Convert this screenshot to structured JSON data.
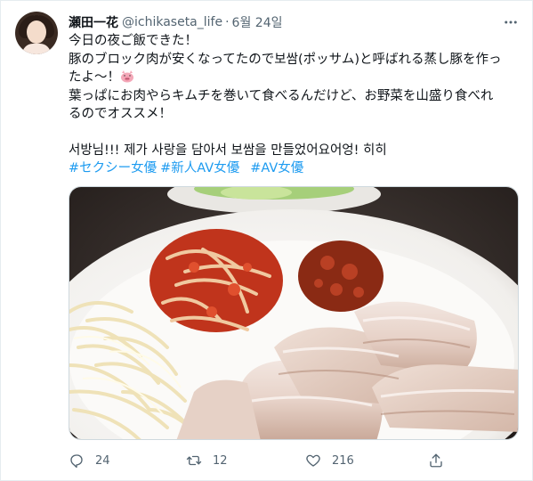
{
  "tweet": {
    "author_name": "瀬田一花",
    "handle": "@ichikaseta_life",
    "separator": "·",
    "date": "6월 24일",
    "text_lines": [
      "今日の夜ご飯できた！",
      "豚のブロック肉が安くなってたので보쌈(ポッサム)と呼ばれる蒸し豚を作っ",
      "たよ〜！",
      "葉っぱにお肉やらキムチを巻いて食べるんだけど、お野菜を山盛り食べれ",
      "るのでオススメ！",
      "",
      "서방님!!! 제가 사랑을 담아서 보쌈을 만들었어요어엉! 히히"
    ],
    "emoji": "pig-face-emoji",
    "hashtags": [
      "#セクシー女優",
      "#新人AV女優",
      "#AV女優"
    ],
    "media_alt": "Plate of bossam: sliced steamed pork, kimchi, bean sprouts, spicy sauce, lettuce"
  },
  "actions": {
    "reply_count": "24",
    "retweet_count": "12",
    "like_count": "216"
  },
  "colors": {
    "text": "#0f1419",
    "secondary": "#536471",
    "link": "#1d9bf0",
    "border": "#e6ecf0"
  }
}
